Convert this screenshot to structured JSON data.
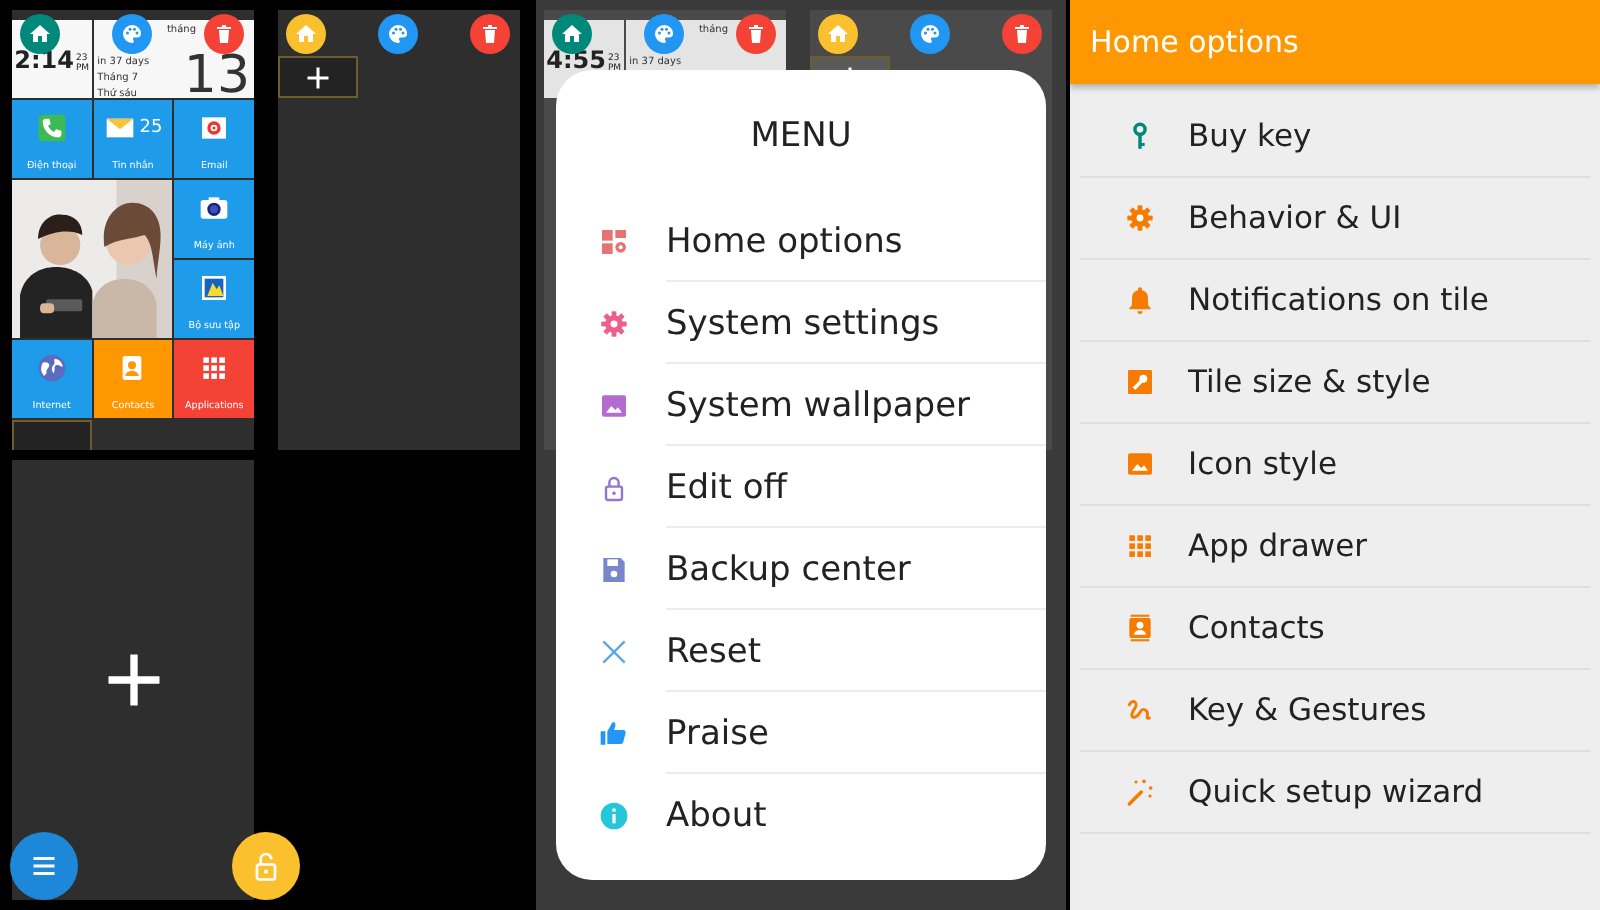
{
  "launcher": {
    "pages": [
      {
        "kind": "tiles",
        "is_home": true,
        "tiles": [
          {
            "kind": "clock",
            "time": "2:14",
            "seconds": "23",
            "period": "PM"
          },
          {
            "kind": "calendar",
            "corner": "tháng",
            "lines": [
              "in 37 days",
              "Tháng 7",
              "Thứ sáu"
            ],
            "day": "13"
          },
          {
            "kind": "app",
            "label": "Điện thoại",
            "color": "#1e9be9"
          },
          {
            "kind": "app",
            "label": "Tin nhắn",
            "count": "25",
            "color": "#1e9be9"
          },
          {
            "kind": "app",
            "label": "Email",
            "color": "#1e9be9"
          },
          {
            "kind": "picture"
          },
          {
            "kind": "app",
            "label": "Máy ảnh",
            "color": "#1e9be9"
          },
          {
            "kind": "app",
            "label": "Bộ sưu tập",
            "color": "#1e9be9"
          },
          {
            "kind": "app",
            "label": "Internet",
            "color": "#1e9be9"
          },
          {
            "kind": "app",
            "label": "Contacts",
            "color": "#ff9800"
          },
          {
            "kind": "app",
            "label": "Applications",
            "color": "#f44336"
          },
          {
            "kind": "empty"
          }
        ]
      },
      {
        "kind": "tiles",
        "is_home": false,
        "tiles": [
          {
            "kind": "add"
          }
        ]
      },
      {
        "kind": "add_page"
      }
    ]
  },
  "menu_screen": {
    "pages": [
      {
        "kind": "tiles",
        "is_home": true,
        "tiles": [
          {
            "kind": "clock",
            "time": "4:55",
            "seconds": "23",
            "period": "PM"
          },
          {
            "kind": "calendar",
            "corner": "tháng",
            "lines": [
              "in 37 days"
            ]
          }
        ]
      },
      {
        "kind": "tiles",
        "is_home": false,
        "tiles": [
          {
            "kind": "add"
          }
        ]
      }
    ],
    "menu": {
      "title": "MENU",
      "items": [
        "Home options",
        "System settings",
        "System wallpaper",
        "Edit off",
        "Backup center",
        "Reset",
        "Praise",
        "About"
      ]
    }
  },
  "home_options": {
    "title": "Home options",
    "items": [
      "Buy key",
      "Behavior & UI",
      "Notifications on tile",
      "Tile size & style",
      "Icon style",
      "App drawer",
      "Contacts",
      "Key & Gestures",
      "Quick setup wizard"
    ]
  }
}
